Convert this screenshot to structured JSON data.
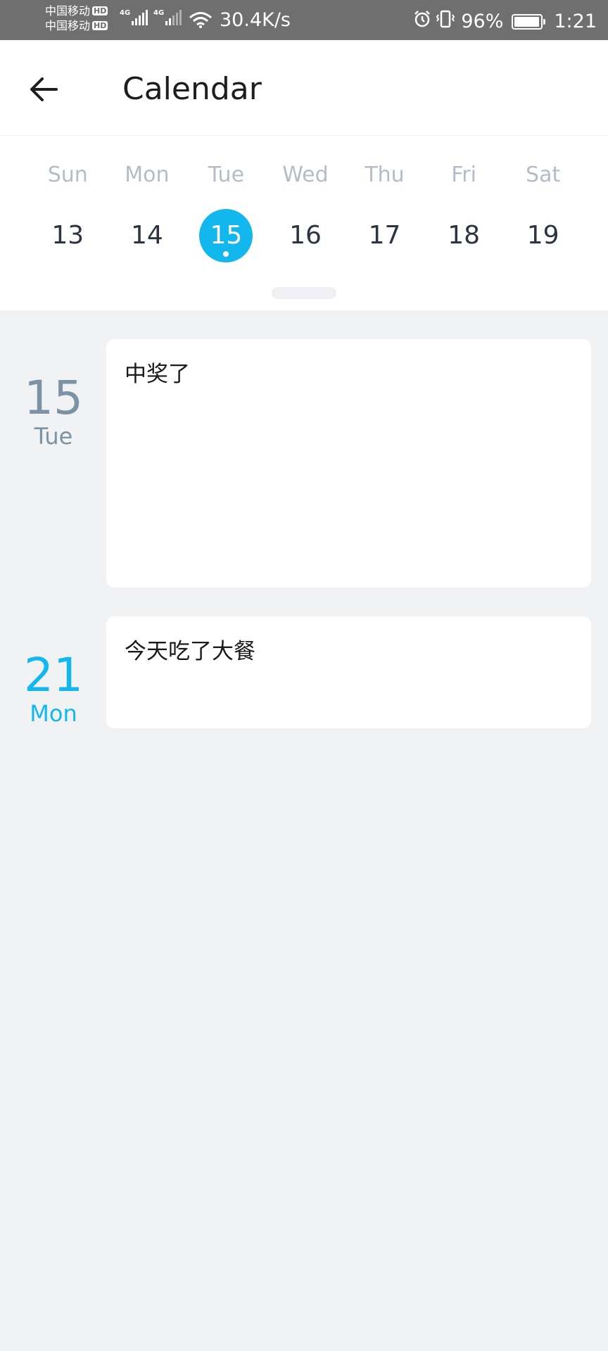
{
  "status_bar": {
    "carrier_1": "中国移动",
    "carrier_2": "中国移动",
    "hd_badge": "HD",
    "network_type": "4G",
    "net_speed": "30.4K/s",
    "battery": "96%",
    "battery_level": 0.96,
    "time": "1:21"
  },
  "header": {
    "title": "Calendar",
    "back_icon": "arrow-left-icon"
  },
  "week": {
    "weekdays": [
      "Sun",
      "Mon",
      "Tue",
      "Wed",
      "Thu",
      "Fri",
      "Sat"
    ],
    "dates": [
      "13",
      "14",
      "15",
      "16",
      "17",
      "18",
      "19"
    ],
    "selected_index": 2,
    "selected_color": "#12b7ee"
  },
  "entries": [
    {
      "day": "15",
      "weekday": "Tue",
      "text": "中奖了"
    },
    {
      "day": "21",
      "weekday": "Mon",
      "text": "今天吃了大餐"
    }
  ],
  "colors": {
    "accent": "#12b7ee",
    "muted_date": "#7c93a6",
    "background": "#f1f2f4"
  }
}
